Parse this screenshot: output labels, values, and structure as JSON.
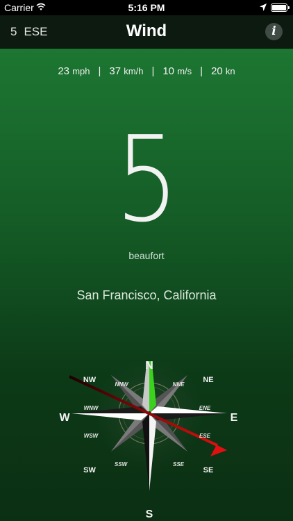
{
  "status": {
    "carrier": "Carrier",
    "time": "5:16 PM"
  },
  "nav": {
    "left_force": "5",
    "left_direction": "ESE",
    "title": "Wind",
    "info_label": "i"
  },
  "speeds": [
    {
      "value": "23",
      "unit": "mph"
    },
    {
      "value": "37",
      "unit": "km/h"
    },
    {
      "value": "10",
      "unit": "m/s"
    },
    {
      "value": "20",
      "unit": "kn"
    }
  ],
  "beaufort": {
    "value": "5",
    "label": "beaufort"
  },
  "location": "San Francisco, California",
  "compass": {
    "cardinal": {
      "n": "N",
      "e": "E",
      "s": "S",
      "w": "W"
    },
    "intercardinal": {
      "ne": "NE",
      "se": "SE",
      "sw": "SW",
      "nw": "NW"
    },
    "secondary": {
      "nne": "NNE",
      "ene": "ENE",
      "ese": "ESE",
      "sse": "SSE",
      "ssw": "SSW",
      "wsw": "WSW",
      "wnw": "WNW",
      "nnw": "NNW"
    },
    "arrow_direction": "ESE",
    "colors": {
      "north_point": "#3bd21e",
      "arrow": "#e01010"
    }
  }
}
